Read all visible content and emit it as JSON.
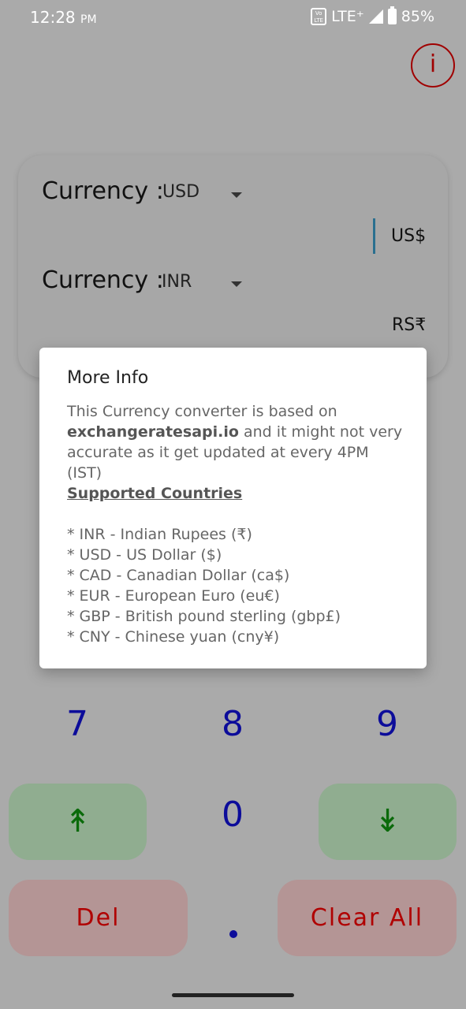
{
  "status_bar": {
    "time": "12:28",
    "ampm": "PM",
    "network": "LTE⁺",
    "battery": "85%"
  },
  "info_button": {
    "label": "i"
  },
  "converter": {
    "from": {
      "label": "Currency :",
      "code": "USD",
      "symbol": "US$"
    },
    "to": {
      "label": "Currency :",
      "code": "INR",
      "symbol": "RS₹"
    }
  },
  "modal": {
    "title": "More Info",
    "body_prefix": "This Currency converter is based on",
    "api_name": "exchangeratesapi.io",
    "body_suffix": "and it might not very accurate as it get updated at every 4PM (IST)",
    "link": "Supported Countries",
    "countries": [
      "* INR - Indian Rupees (₹)",
      "* USD - US Dollar ($)",
      "* CAD - Canadian Dollar (ca$)",
      "* EUR - European Euro (eu€)",
      "* GBP - British pound sterling (gbp£)",
      "* CNY - Chinese yuan (cny¥)"
    ]
  },
  "keypad": {
    "seven": "7",
    "eight": "8",
    "nine": "9",
    "zero": "0",
    "up": "↟",
    "down": "↡",
    "delete": "Del",
    "clear": "Clear All"
  }
}
